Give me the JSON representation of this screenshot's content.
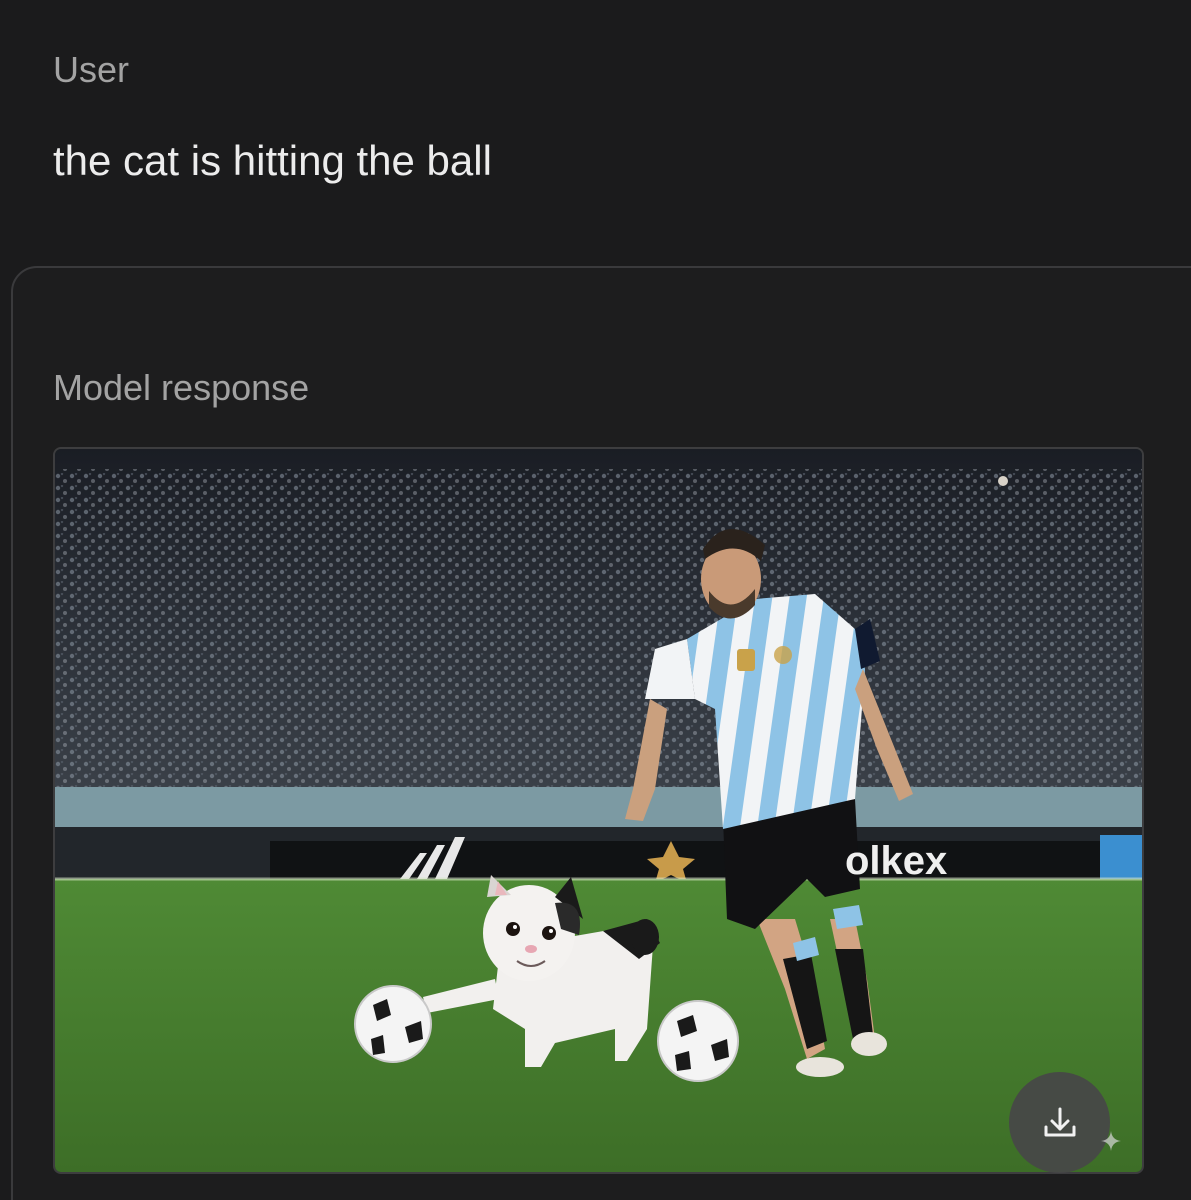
{
  "conversation": {
    "user_label": "User",
    "user_message": "the cat is hitting the ball",
    "model_label": "Model response"
  },
  "generated_image": {
    "description_icon": "generated-image",
    "banner_text": "olkex"
  },
  "actions": {
    "download_icon": "download-icon",
    "sparkle_icon": "sparkle-icon"
  },
  "colors": {
    "background": "#1b1b1c",
    "label_gray": "#a3a3a3",
    "text_white": "#ececec",
    "card_border": "#3a3a3c",
    "button_bg": "#464648"
  }
}
